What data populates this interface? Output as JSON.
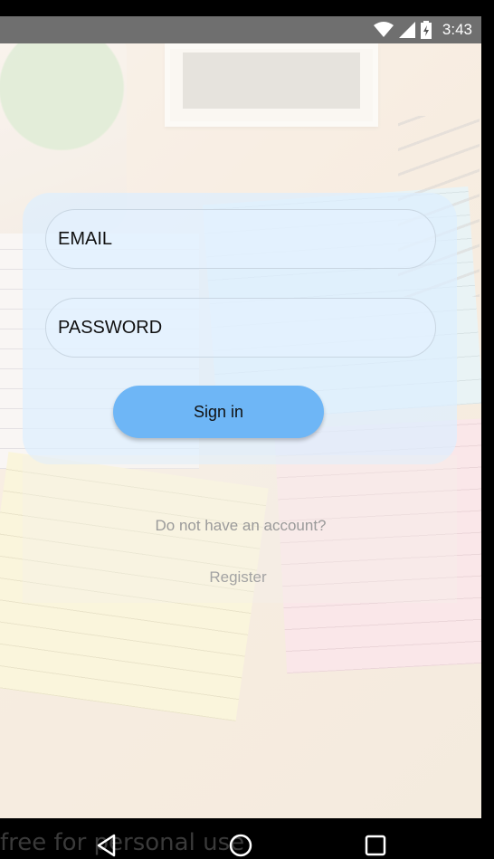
{
  "status_bar": {
    "time": "3:43",
    "icons": [
      "wifi-icon",
      "cell-signal-icon",
      "battery-charging-icon"
    ]
  },
  "login": {
    "email_placeholder": "EMAIL",
    "password_placeholder": "PASSWORD",
    "signin_label": "Sign in",
    "no_account_text": "Do not have an account?",
    "register_label": "Register"
  },
  "watermark": "free for personal use",
  "nav_bar": {
    "icons": [
      "back-icon",
      "home-icon",
      "recents-icon"
    ]
  },
  "colors": {
    "button": "#6eb6f6",
    "card": "#dceeff",
    "status_bar": "#6f6f6f"
  }
}
